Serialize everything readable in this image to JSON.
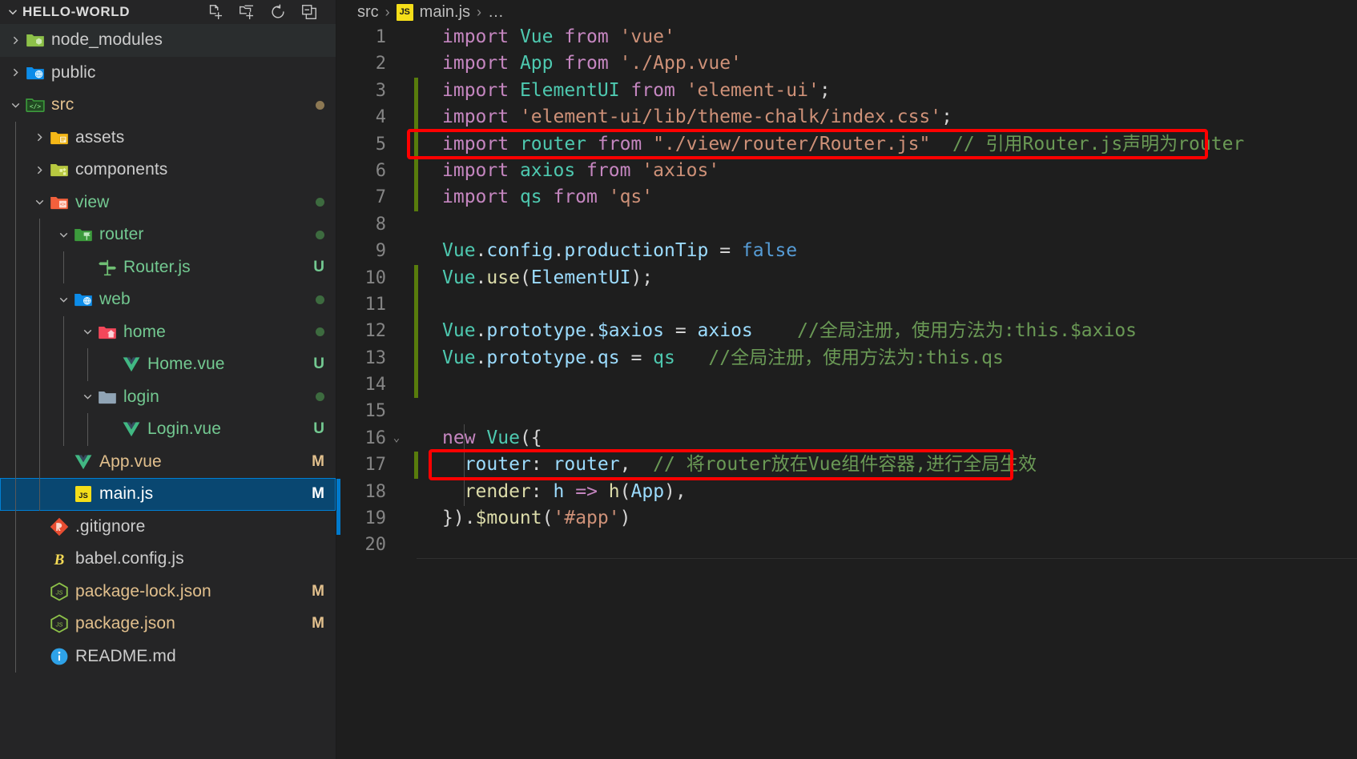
{
  "window": {
    "theme": "dark-plus",
    "colors": {
      "sidebar_bg": "#252526",
      "editor_bg": "#1E1E1E",
      "selection_blue": "#094771",
      "selection_border": "#007FD4",
      "annotation_red": "#FF0000",
      "modified_gutter_green": "#587C0C",
      "badge_modified": "#E2C08D",
      "badge_untracked": "#73C991"
    }
  },
  "sidebar": {
    "title": "HELLO-WORLD",
    "header_chevron": "chevron-down-icon",
    "actions": [
      {
        "name": "new-file-icon",
        "tooltip": "New File"
      },
      {
        "name": "new-folder-icon",
        "tooltip": "New Folder"
      },
      {
        "name": "refresh-icon",
        "tooltip": "Refresh Explorer"
      },
      {
        "name": "collapse-all-icon",
        "tooltip": "Collapse Folders in Explorer"
      }
    ],
    "tree": [
      {
        "label": "node_modules",
        "depth": 0,
        "type": "folder",
        "icon": "folder-node-modules-icon",
        "expanded": false,
        "badge": "",
        "badge_kind": "",
        "color": "#cccccc",
        "hovered": true,
        "selected": false
      },
      {
        "label": "public",
        "depth": 0,
        "type": "folder",
        "icon": "folder-public-icon",
        "expanded": false,
        "badge": "",
        "badge_kind": "",
        "color": "#cccccc",
        "hovered": false,
        "selected": false
      },
      {
        "label": "src",
        "depth": 0,
        "type": "folder",
        "icon": "folder-src-icon",
        "expanded": true,
        "badge": "dot",
        "badge_kind": "modified-dot",
        "color": "#E2C08D",
        "hovered": false,
        "selected": false
      },
      {
        "label": "assets",
        "depth": 1,
        "type": "folder",
        "icon": "folder-assets-icon",
        "expanded": false,
        "badge": "",
        "badge_kind": "",
        "color": "#cccccc",
        "hovered": false,
        "selected": false
      },
      {
        "label": "components",
        "depth": 1,
        "type": "folder",
        "icon": "folder-components-icon",
        "expanded": false,
        "badge": "",
        "badge_kind": "",
        "color": "#cccccc",
        "hovered": false,
        "selected": false
      },
      {
        "label": "view",
        "depth": 1,
        "type": "folder",
        "icon": "folder-view-icon",
        "expanded": true,
        "badge": "dot",
        "badge_kind": "untracked-dot",
        "color": "#73C991",
        "hovered": false,
        "selected": false
      },
      {
        "label": "router",
        "depth": 2,
        "type": "folder",
        "icon": "folder-router-icon",
        "expanded": true,
        "badge": "dot",
        "badge_kind": "untracked-dot",
        "color": "#73C991",
        "hovered": false,
        "selected": false
      },
      {
        "label": "Router.js",
        "depth": 3,
        "type": "file",
        "icon": "router-signpost-icon",
        "expanded": null,
        "badge": "U",
        "badge_kind": "untracked",
        "color": "#73C991",
        "hovered": false,
        "selected": false
      },
      {
        "label": "web",
        "depth": 2,
        "type": "folder",
        "icon": "folder-web-icon",
        "expanded": true,
        "badge": "dot",
        "badge_kind": "untracked-dot",
        "color": "#73C991",
        "hovered": false,
        "selected": false
      },
      {
        "label": "home",
        "depth": 3,
        "type": "folder",
        "icon": "folder-home-icon",
        "expanded": true,
        "badge": "dot",
        "badge_kind": "untracked-dot",
        "color": "#73C991",
        "hovered": false,
        "selected": false
      },
      {
        "label": "Home.vue",
        "depth": 4,
        "type": "file",
        "icon": "vue-icon",
        "expanded": null,
        "badge": "U",
        "badge_kind": "untracked",
        "color": "#73C991",
        "hovered": false,
        "selected": false
      },
      {
        "label": "login",
        "depth": 3,
        "type": "folder",
        "icon": "folder-generic-icon",
        "expanded": true,
        "badge": "dot",
        "badge_kind": "untracked-dot",
        "color": "#73C991",
        "hovered": false,
        "selected": false
      },
      {
        "label": "Login.vue",
        "depth": 4,
        "type": "file",
        "icon": "vue-icon",
        "expanded": null,
        "badge": "U",
        "badge_kind": "untracked",
        "color": "#73C991",
        "hovered": false,
        "selected": false
      },
      {
        "label": "App.vue",
        "depth": 2,
        "type": "file",
        "icon": "vue-icon",
        "expanded": null,
        "badge": "M",
        "badge_kind": "modified",
        "color": "#E2C08D",
        "hovered": false,
        "selected": false
      },
      {
        "label": "main.js",
        "depth": 2,
        "type": "file",
        "icon": "js-icon",
        "expanded": null,
        "badge": "M",
        "badge_kind": "modified",
        "color": "#FFFFFF",
        "hovered": false,
        "selected": true
      },
      {
        "label": ".gitignore",
        "depth": 1,
        "type": "file",
        "icon": "git-icon",
        "expanded": null,
        "badge": "",
        "badge_kind": "",
        "color": "#cccccc",
        "hovered": false,
        "selected": false
      },
      {
        "label": "babel.config.js",
        "depth": 1,
        "type": "file",
        "icon": "babel-icon",
        "expanded": null,
        "badge": "",
        "badge_kind": "",
        "color": "#cccccc",
        "hovered": false,
        "selected": false
      },
      {
        "label": "package-lock.json",
        "depth": 1,
        "type": "file",
        "icon": "nodejs-icon",
        "expanded": null,
        "badge": "M",
        "badge_kind": "modified",
        "color": "#E2C08D",
        "hovered": false,
        "selected": false
      },
      {
        "label": "package.json",
        "depth": 1,
        "type": "file",
        "icon": "nodejs-icon",
        "expanded": null,
        "badge": "M",
        "badge_kind": "modified",
        "color": "#E2C08D",
        "hovered": false,
        "selected": false
      },
      {
        "label": "README.md",
        "depth": 1,
        "type": "file",
        "icon": "readme-info-icon",
        "expanded": null,
        "badge": "",
        "badge_kind": "",
        "color": "#cccccc",
        "hovered": false,
        "selected": false
      }
    ]
  },
  "editor": {
    "breadcrumb": [
      {
        "text": "src",
        "icon": ""
      },
      {
        "text": "main.js",
        "icon": "js-icon"
      },
      {
        "text": "…",
        "icon": ""
      }
    ],
    "breadcrumb_separator": "›",
    "active_file": "main.js",
    "lines": [
      {
        "n": 1,
        "modified": false,
        "fold": "",
        "tokens": [
          {
            "t": "import ",
            "c": "t-kw"
          },
          {
            "t": "Vue",
            "c": "t-cls"
          },
          {
            "t": " from ",
            "c": "t-kw"
          },
          {
            "t": "'vue'",
            "c": "t-str"
          }
        ]
      },
      {
        "n": 2,
        "modified": false,
        "fold": "",
        "tokens": [
          {
            "t": "import ",
            "c": "t-kw"
          },
          {
            "t": "App",
            "c": "t-cls"
          },
          {
            "t": " from ",
            "c": "t-kw"
          },
          {
            "t": "'./App.vue'",
            "c": "t-str"
          }
        ]
      },
      {
        "n": 3,
        "modified": true,
        "fold": "",
        "tokens": [
          {
            "t": "import ",
            "c": "t-kw"
          },
          {
            "t": "ElementUI",
            "c": "t-cls"
          },
          {
            "t": " from ",
            "c": "t-kw"
          },
          {
            "t": "'element-ui'",
            "c": "t-str"
          },
          {
            "t": ";",
            "c": "t-plain"
          }
        ]
      },
      {
        "n": 4,
        "modified": true,
        "fold": "",
        "tokens": [
          {
            "t": "import ",
            "c": "t-kw"
          },
          {
            "t": "'element-ui/lib/theme-chalk/index.css'",
            "c": "t-str"
          },
          {
            "t": ";",
            "c": "t-plain"
          }
        ]
      },
      {
        "n": 5,
        "modified": true,
        "fold": "",
        "tokens": [
          {
            "t": "import ",
            "c": "t-kw"
          },
          {
            "t": "router",
            "c": "t-cls"
          },
          {
            "t": " from ",
            "c": "t-kw"
          },
          {
            "t": "\"./view/router/Router.js\"",
            "c": "t-str"
          },
          {
            "t": "  ",
            "c": "t-plain"
          },
          {
            "t": "// 引用Router.js声明为router",
            "c": "t-cmt"
          }
        ]
      },
      {
        "n": 6,
        "modified": true,
        "fold": "",
        "tokens": [
          {
            "t": "import ",
            "c": "t-kw"
          },
          {
            "t": "axios",
            "c": "t-cls"
          },
          {
            "t": " from ",
            "c": "t-kw"
          },
          {
            "t": "'axios'",
            "c": "t-str"
          }
        ]
      },
      {
        "n": 7,
        "modified": true,
        "fold": "",
        "tokens": [
          {
            "t": "import ",
            "c": "t-kw"
          },
          {
            "t": "qs",
            "c": "t-cls"
          },
          {
            "t": " from ",
            "c": "t-kw"
          },
          {
            "t": "'qs'",
            "c": "t-str"
          }
        ]
      },
      {
        "n": 8,
        "modified": false,
        "fold": "",
        "tokens": []
      },
      {
        "n": 9,
        "modified": false,
        "fold": "",
        "tokens": [
          {
            "t": "Vue",
            "c": "t-cls"
          },
          {
            "t": ".",
            "c": "t-plain"
          },
          {
            "t": "config",
            "c": "t-var"
          },
          {
            "t": ".",
            "c": "t-plain"
          },
          {
            "t": "productionTip",
            "c": "t-var"
          },
          {
            "t": " = ",
            "c": "t-plain"
          },
          {
            "t": "false",
            "c": "t-kw2"
          }
        ]
      },
      {
        "n": 10,
        "modified": true,
        "fold": "",
        "tokens": [
          {
            "t": "Vue",
            "c": "t-cls"
          },
          {
            "t": ".",
            "c": "t-plain"
          },
          {
            "t": "use",
            "c": "t-fn"
          },
          {
            "t": "(",
            "c": "t-plain"
          },
          {
            "t": "ElementUI",
            "c": "t-var"
          },
          {
            "t": ");",
            "c": "t-plain"
          }
        ]
      },
      {
        "n": 11,
        "modified": true,
        "fold": "",
        "tokens": []
      },
      {
        "n": 12,
        "modified": true,
        "fold": "",
        "tokens": [
          {
            "t": "Vue",
            "c": "t-cls"
          },
          {
            "t": ".",
            "c": "t-plain"
          },
          {
            "t": "prototype",
            "c": "t-var"
          },
          {
            "t": ".",
            "c": "t-plain"
          },
          {
            "t": "$axios",
            "c": "t-var"
          },
          {
            "t": " = ",
            "c": "t-plain"
          },
          {
            "t": "axios",
            "c": "t-var"
          },
          {
            "t": "    ",
            "c": "t-plain"
          },
          {
            "t": "//全局注册，使用方法为:this.$axios",
            "c": "t-cmt"
          }
        ]
      },
      {
        "n": 13,
        "modified": true,
        "fold": "",
        "tokens": [
          {
            "t": "Vue",
            "c": "t-cls"
          },
          {
            "t": ".",
            "c": "t-plain"
          },
          {
            "t": "prototype",
            "c": "t-var"
          },
          {
            "t": ".",
            "c": "t-plain"
          },
          {
            "t": "qs",
            "c": "t-var"
          },
          {
            "t": " = ",
            "c": "t-plain"
          },
          {
            "t": "qs",
            "c": "t-cls"
          },
          {
            "t": "   ",
            "c": "t-plain"
          },
          {
            "t": "//全局注册，使用方法为:this.qs",
            "c": "t-cmt"
          }
        ]
      },
      {
        "n": 14,
        "modified": true,
        "fold": "",
        "tokens": []
      },
      {
        "n": 15,
        "modified": false,
        "fold": "",
        "tokens": []
      },
      {
        "n": 16,
        "modified": false,
        "fold": "⌄",
        "tokens": [
          {
            "t": "new ",
            "c": "t-kw"
          },
          {
            "t": "Vue",
            "c": "t-cls"
          },
          {
            "t": "({",
            "c": "t-plain"
          }
        ]
      },
      {
        "n": 17,
        "modified": true,
        "fold": "",
        "tokens": [
          {
            "t": "  ",
            "c": "t-plain"
          },
          {
            "t": "router",
            "c": "t-var"
          },
          {
            "t": ": ",
            "c": "t-plain"
          },
          {
            "t": "router",
            "c": "t-var"
          },
          {
            "t": ",",
            "c": "t-plain"
          },
          {
            "t": "  ",
            "c": "t-plain"
          },
          {
            "t": "// 将router放在Vue组件容器,进行全局生效",
            "c": "t-cmt"
          }
        ]
      },
      {
        "n": 18,
        "modified": false,
        "fold": "",
        "tokens": [
          {
            "t": "  ",
            "c": "t-plain"
          },
          {
            "t": "render",
            "c": "t-fn"
          },
          {
            "t": ": ",
            "c": "t-plain"
          },
          {
            "t": "h",
            "c": "t-var"
          },
          {
            "t": " ",
            "c": "t-plain"
          },
          {
            "t": "=>",
            "c": "t-kw"
          },
          {
            "t": " ",
            "c": "t-plain"
          },
          {
            "t": "h",
            "c": "t-fn"
          },
          {
            "t": "(",
            "c": "t-plain"
          },
          {
            "t": "App",
            "c": "t-var"
          },
          {
            "t": "),",
            "c": "t-plain"
          }
        ]
      },
      {
        "n": 19,
        "modified": false,
        "fold": "",
        "tokens": [
          {
            "t": "}).",
            "c": "t-plain"
          },
          {
            "t": "$mount",
            "c": "t-fn"
          },
          {
            "t": "(",
            "c": "t-plain"
          },
          {
            "t": "'#app'",
            "c": "t-str"
          },
          {
            "t": ")",
            "c": "t-plain"
          }
        ]
      },
      {
        "n": 20,
        "modified": false,
        "fold": "",
        "tokens": []
      }
    ],
    "annotations": [
      {
        "name": "annotation-box-line-5",
        "line": 5,
        "label": "red rectangle around import router statement"
      },
      {
        "name": "annotation-box-line-17",
        "line": 17,
        "label": "red rectangle around router: router option"
      }
    ],
    "cursor_line": 20
  }
}
